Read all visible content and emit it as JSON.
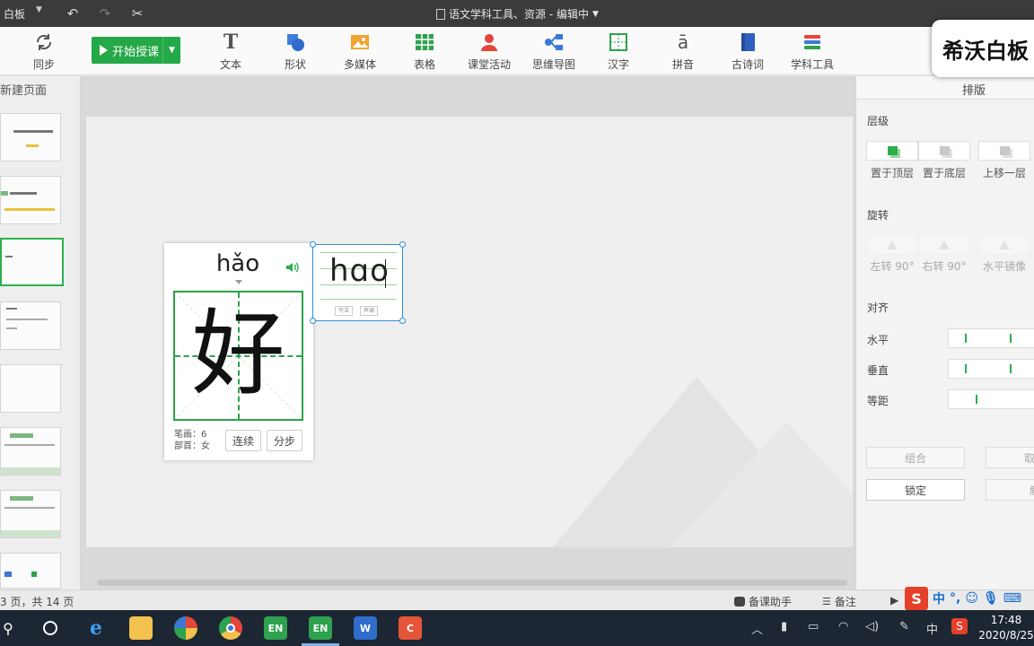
{
  "titlebar": {
    "app_name": "白板",
    "doc_title": "语文学科工具、资源 - 编辑中"
  },
  "toolbar": {
    "sync_label": "同步",
    "start_label": "开始授课",
    "tools": [
      {
        "label": "文本",
        "icon": "text-icon"
      },
      {
        "label": "形状",
        "icon": "shape-icon"
      },
      {
        "label": "多媒体",
        "icon": "image-icon"
      },
      {
        "label": "表格",
        "icon": "table-icon"
      },
      {
        "label": "课堂活动",
        "icon": "person-icon"
      },
      {
        "label": "思维导图",
        "icon": "mindmap-icon"
      },
      {
        "label": "汉字",
        "icon": "hanzi-icon"
      },
      {
        "label": "拼音",
        "icon": "pinyin-icon"
      },
      {
        "label": "古诗词",
        "icon": "book-icon"
      },
      {
        "label": "学科工具",
        "icon": "layers-icon"
      }
    ],
    "accent": "#25a847"
  },
  "left_panel": {
    "title": "新建页面"
  },
  "hanzi_card": {
    "pinyin": "hǎo",
    "character": "好",
    "strokes_label": "笔画：6",
    "radical_label": "部首：女",
    "continuous_label": "连续",
    "step_label": "分步"
  },
  "pinyin_box": {
    "text": "hɑo",
    "mini_left": "写法",
    "mini_right": "声调"
  },
  "right_panel": {
    "tab": "排版",
    "layer_title": "层级",
    "layer_buttons": [
      "置于顶层",
      "置于底层",
      "上移一层"
    ],
    "rotate_title": "旋转",
    "rotate_buttons": [
      "左转 90°",
      "右转 90°",
      "水平镜像"
    ],
    "align_title": "对齐",
    "align_rows": [
      "水平",
      "垂直",
      "等距"
    ],
    "group_label": "组合",
    "ungroup_label": "取消",
    "lock_label": "锁定",
    "unlock_label": "解"
  },
  "statusbar": {
    "page_info": "3 页，共 14 页",
    "assistant_label": "备课助手",
    "notes_label": "备注"
  },
  "ime": {
    "mode": "中"
  },
  "taskbar": {
    "time": "17:48",
    "date": "2020/8/25",
    "tray_lang": "中"
  },
  "watermark": {
    "text": "希沃白板"
  }
}
